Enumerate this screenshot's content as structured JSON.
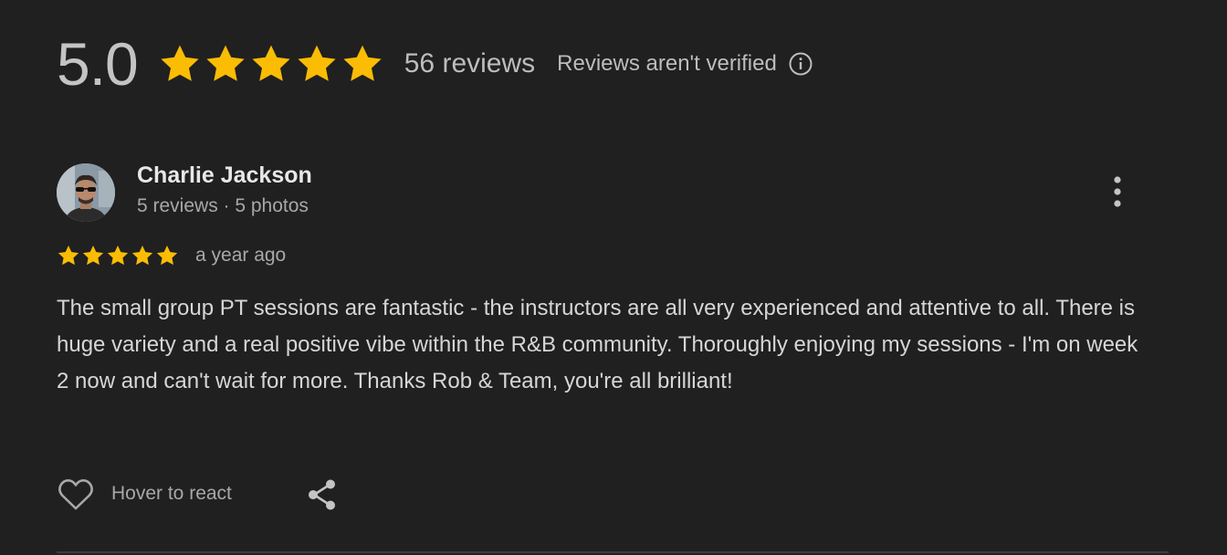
{
  "summary": {
    "rating": "5.0",
    "stars": 5,
    "review_count": "56 reviews",
    "verification_note": "Reviews aren't verified",
    "star_color": "#fbbc04"
  },
  "review": {
    "reviewer_name": "Charlie Jackson",
    "reviewer_meta": "5 reviews · 5 photos",
    "rating_stars": 5,
    "date": "a year ago",
    "text": "The small group PT sessions are fantastic - the instructors are all very experienced and attentive to all. There is huge variety and a real positive vibe within the R&B community. Thoroughly enjoying my sessions - I'm on week 2 now and can't wait for more. Thanks Rob & Team, you're all brilliant!",
    "react_label": "Hover to react",
    "icons": {
      "more": "more-vert-icon",
      "react": "heart-icon",
      "share": "share-icon",
      "info": "info-icon"
    }
  }
}
